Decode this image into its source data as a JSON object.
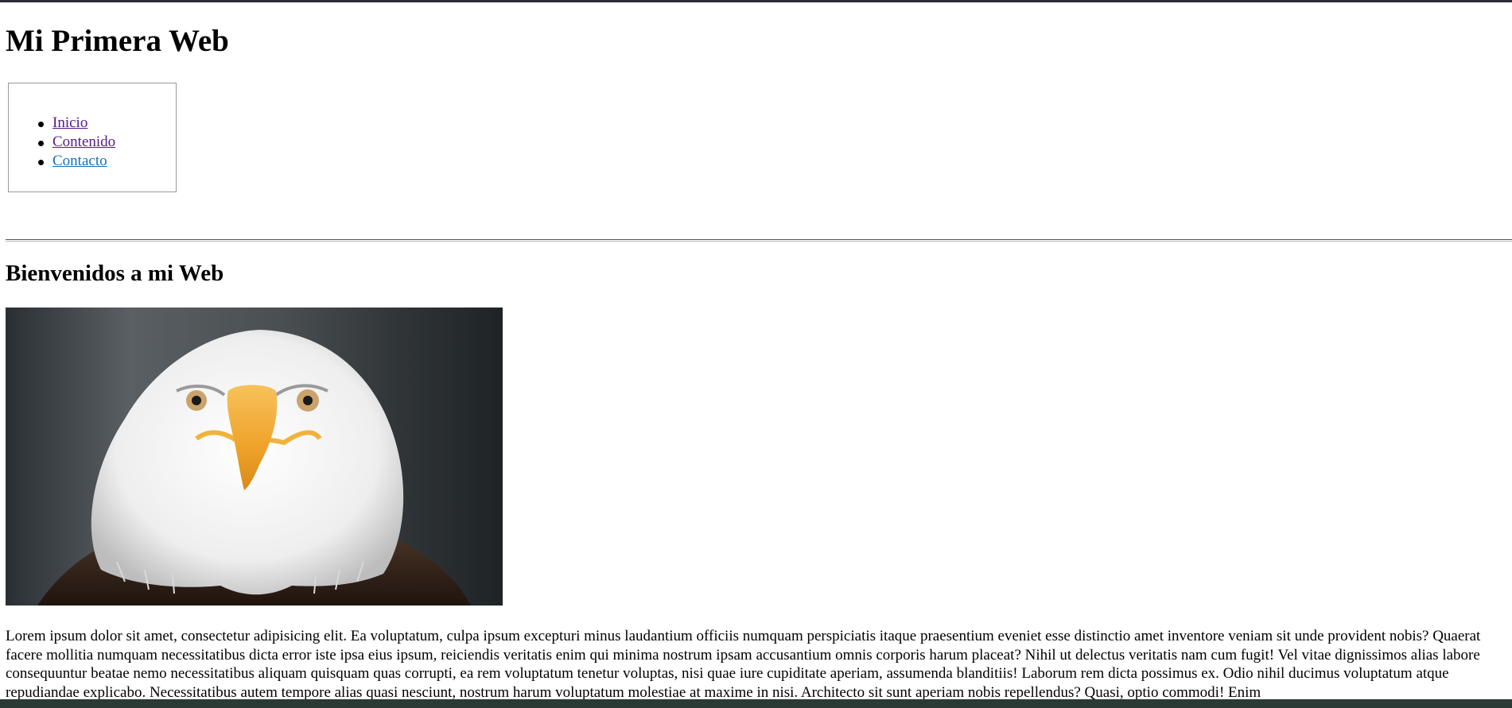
{
  "page": {
    "title": "Mi Primera Web",
    "nav": {
      "items": [
        {
          "label": "Inicio",
          "state": "visited"
        },
        {
          "label": "Contenido",
          "state": "visited"
        },
        {
          "label": "Contacto",
          "state": "unvisited"
        }
      ]
    },
    "welcome_heading": "Bienvenidos a mi Web",
    "image": {
      "subject": "bald-eagle-portrait",
      "colors": {
        "background": "#3a3f42",
        "head": "#f2f2f2",
        "beak": "#f0a52a",
        "body": "#3b2a1e"
      }
    },
    "paragraph": "Lorem ipsum dolor sit amet, consectetur adipisicing elit. Ea voluptatum, culpa ipsum excepturi minus laudantium officiis numquam perspiciatis itaque praesentium eveniet esse distinctio amet inventore veniam sit unde provident nobis? Quaerat facere mollitia numquam necessitatibus dicta error iste ipsa eius ipsum, reiciendis veritatis enim qui minima nostrum ipsam accusantium omnis corporis harum placeat? Nihil ut delectus veritatis nam cum fugit! Vel vitae dignissimos alias labore consequuntur beatae nemo necessitatibus aliquam quisquam quas corrupti, ea rem voluptatum tenetur voluptas, nisi quae iure cupiditate aperiam, assumenda blanditiis! Laborum rem dicta possimus ex. Odio nihil ducimus voluptatum atque repudiandae explicabo. Necessitatibus autem tempore alias quasi nesciunt, nostrum harum voluptatum molestiae at maxime in nisi. Architecto sit sunt aperiam nobis repellendus? Quasi, optio commodi! Enim"
  }
}
